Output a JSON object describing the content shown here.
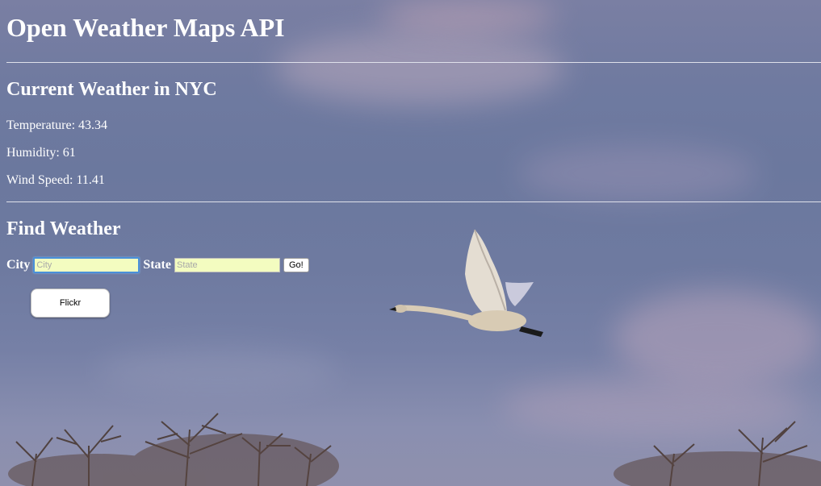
{
  "header": {
    "title": "Open Weather Maps API"
  },
  "current_weather": {
    "heading": "Current Weather in NYC",
    "temperature": "Temperature: 43.34",
    "humidity": "Humidity: 61",
    "wind_speed": "Wind Speed: 11.41"
  },
  "find_weather": {
    "heading": "Find Weather",
    "city_label": "City",
    "city_placeholder": "City",
    "city_value": "",
    "state_label": "State",
    "state_placeholder": "State",
    "state_value": "",
    "go_label": "Go!"
  },
  "flickr": {
    "label": "Flickr"
  },
  "background": {
    "icon": "swan-photo",
    "sky_color": "#6f7aa0"
  }
}
